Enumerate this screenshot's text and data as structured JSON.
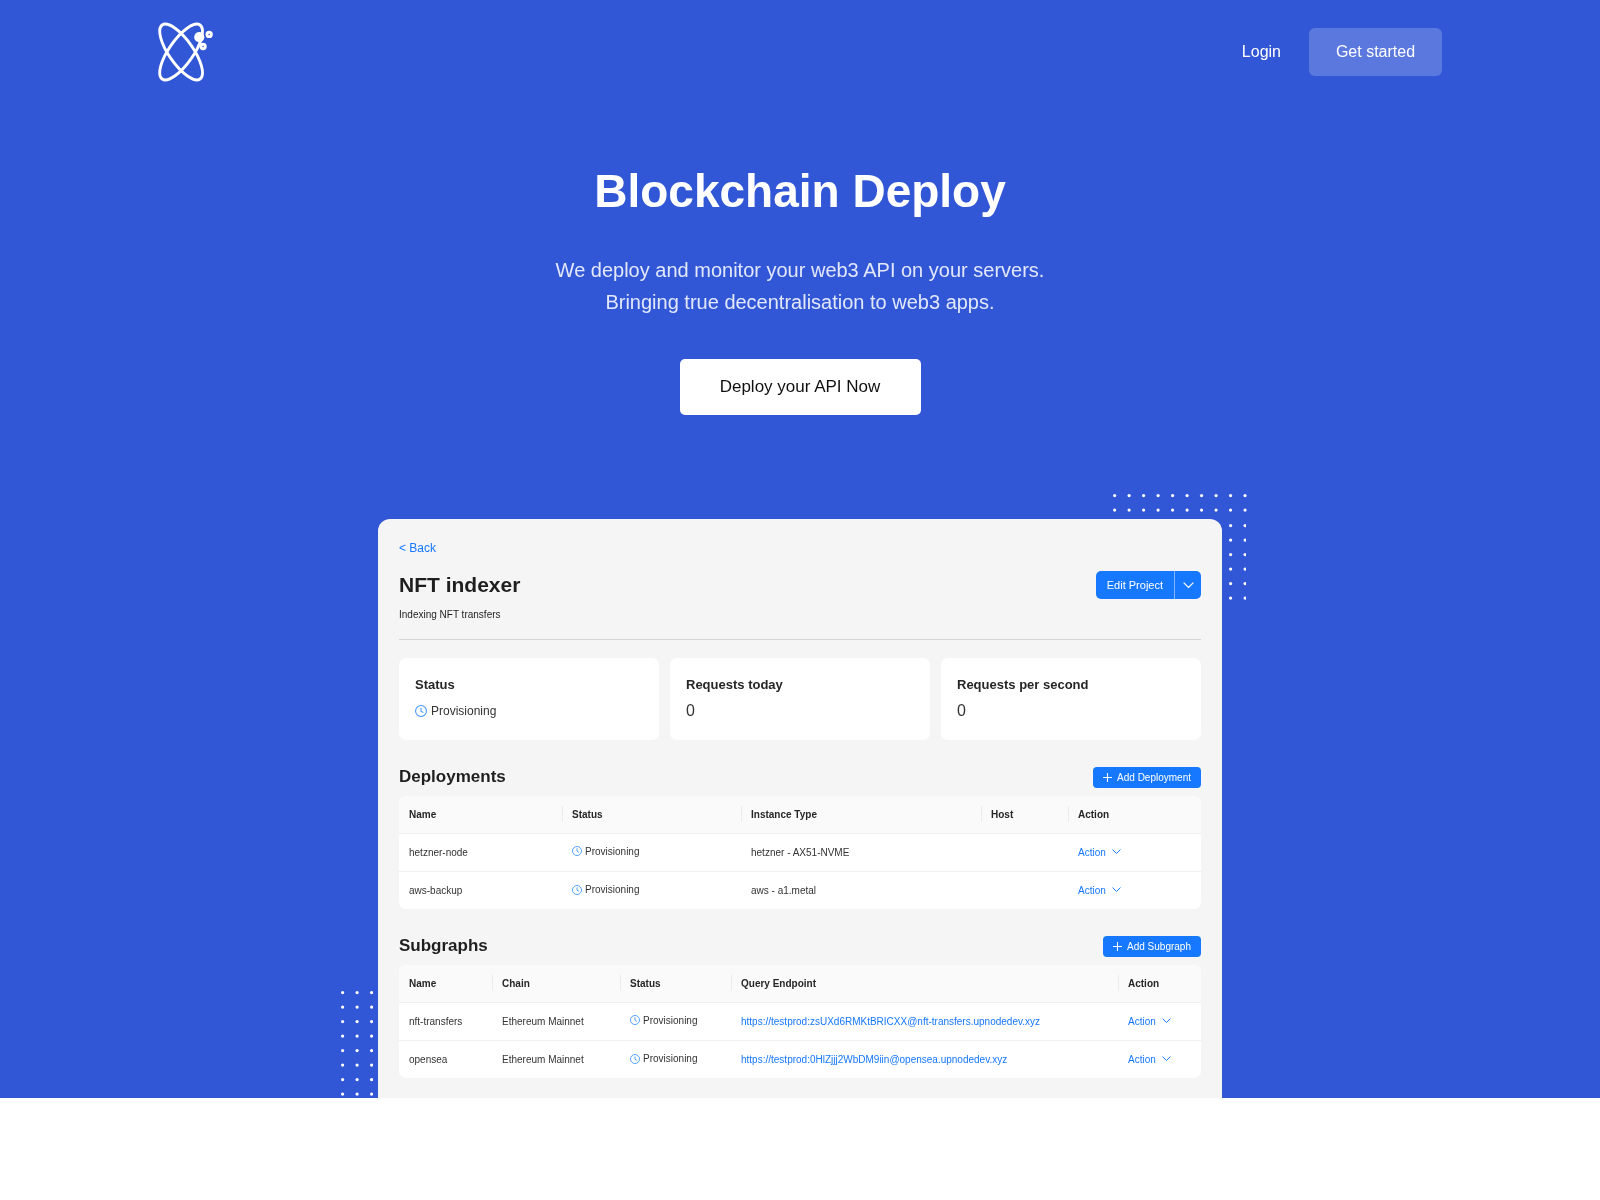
{
  "header": {
    "login": "Login",
    "get_started": "Get started"
  },
  "hero": {
    "title": "Blockchain Deploy",
    "subtitle_lines": [
      "We deploy and monitor your web3 API on your servers.",
      "Bringing true decentralisation to web3 apps."
    ],
    "button": "Deploy your API Now"
  },
  "dashboard": {
    "back": "< Back",
    "title": "NFT indexer",
    "description": "Indexing NFT transfers",
    "edit_button": "Edit Project",
    "stats": [
      {
        "label": "Status",
        "value": "Provisioning",
        "kind": "status"
      },
      {
        "label": "Requests today",
        "value": "0",
        "kind": "count"
      },
      {
        "label": "Requests per second",
        "value": "0",
        "kind": "count"
      }
    ],
    "deployments": {
      "title": "Deployments",
      "add_button": "Add Deployment",
      "columns": [
        "Name",
        "Status",
        "Instance Type",
        "Host",
        "Action"
      ],
      "rows": [
        {
          "name": "hetzner-node",
          "status": "Provisioning",
          "instance_type": "hetzner - AX51-NVME",
          "action": "Action"
        },
        {
          "name": "aws-backup",
          "status": "Provisioning",
          "instance_type": "aws - a1.metal",
          "action": "Action"
        }
      ]
    },
    "subgraphs": {
      "title": "Subgraphs",
      "add_button": "Add Subgraph",
      "columns": [
        "Name",
        "Chain",
        "Status",
        "Query Endpoint",
        "Action"
      ],
      "rows": [
        {
          "name": "nft-transfers",
          "chain": "Ethereum Mainnet",
          "status": "Provisioning",
          "query_endpoint": "https://testprod:zsUXd6RMKtBRICXX@nft-transfers.upnodedev.xyz",
          "action": "Action"
        },
        {
          "name": "opensea",
          "chain": "Ethereum Mainnet",
          "status": "Provisioning",
          "query_endpoint": "https://testprod:0HlZjjj2WbDM9iin@opensea.upnodedev.xyz",
          "action": "Action"
        }
      ]
    }
  }
}
